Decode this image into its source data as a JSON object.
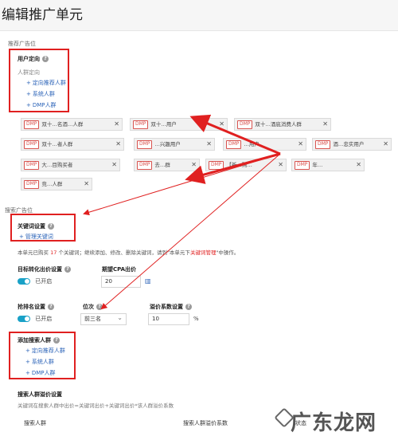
{
  "page_title": "编辑推广单元",
  "recommend_section": {
    "label": "推荐广告位"
  },
  "user_targeting": {
    "heading": "用户定向",
    "sub_label": "人群定向",
    "links": [
      "定向推荐人群",
      "系统人群",
      "DMP人群"
    ]
  },
  "audience_tags": [
    {
      "badge": "DMP",
      "text": "双十…名酒…人群"
    },
    {
      "badge": "DMP",
      "text": "双十…用户"
    },
    {
      "badge": "DMP",
      "text": "双十…酒底消费人群"
    },
    {
      "badge": "DMP",
      "text": "双十…者人群"
    },
    {
      "badge": "DMP",
      "text": "…兴趣用户"
    },
    {
      "badge": "DMP",
      "text": "…用户"
    },
    {
      "badge": "DMP",
      "text": "酒…忠实用户"
    },
    {
      "badge": "DMP",
      "text": "大…目购买者"
    },
    {
      "badge": "DMP",
      "text": "去…群"
    },
    {
      "badge": "DMP",
      "text": "【新…购…"
    },
    {
      "badge": "DMP",
      "text": "年…"
    },
    {
      "badge": "DMP",
      "text": "竞…人群"
    }
  ],
  "search_section": {
    "label": "搜索广告位"
  },
  "keyword_settings": {
    "heading": "关键词设置",
    "manage_link": "管理关键词",
    "info_prefix": "本单元已购买",
    "info_count": "17",
    "info_middle": "个关键词；继续添加、修改、删除关键词，请到\"本单元下",
    "info_link": "关键词管理",
    "info_suffix": "\"中操作。"
  },
  "bid_target": {
    "label": "目标转化出价设置",
    "toggle_text": "已开启"
  },
  "cpa": {
    "label": "期望CPA出价",
    "value": "20",
    "icon": "chart-icon"
  },
  "rank": {
    "label": "抢排名设置",
    "toggle_text": "已开启"
  },
  "position": {
    "label": "位次",
    "value": "前三名"
  },
  "premium": {
    "label": "溢价系数设置",
    "value": "10",
    "unit": "%"
  },
  "add_search_audience": {
    "heading": "添加搜索人群",
    "links": [
      "定向推荐人群",
      "系统人群",
      "DMP人群"
    ]
  },
  "search_audience_bid": {
    "heading": "搜索人群溢价设置",
    "desc": "关键词在搜索人群中出价=关键词出价+关键词出价*该人群溢价系数"
  },
  "table_headers": [
    "搜索人群",
    "搜索人群溢价系数",
    "状态"
  ],
  "watermark": "广东龙网",
  "colors": {
    "accent": "#19a1c7",
    "link": "#2b63b8",
    "annotation": "#e02020"
  }
}
